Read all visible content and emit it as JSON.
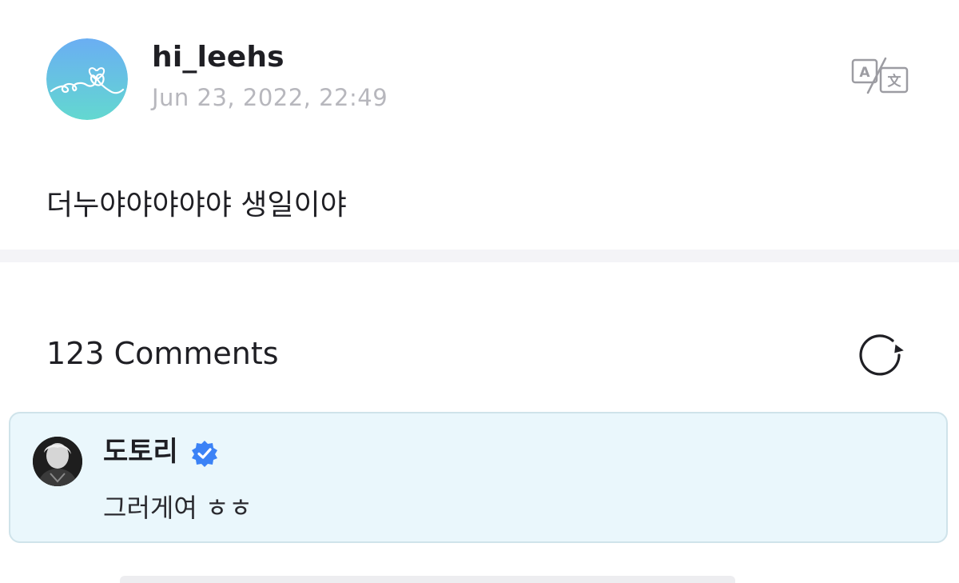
{
  "post": {
    "author": "hi_leehs",
    "timestamp": "Jun 23, 2022, 22:49",
    "body": "더누야야야야야 생일이야",
    "avatar_icon": "heart-doodle-icon",
    "translate_icon": "translate-icon"
  },
  "comments": {
    "count_label": "123 Comments",
    "refresh_icon": "refresh-icon",
    "items": [
      {
        "author": "도토리",
        "verified": true,
        "text": "그러게여 ㅎㅎ"
      }
    ]
  },
  "colors": {
    "primary_text": "#1f1f24",
    "muted_text": "#b7b7bd",
    "card_background": "#eaf7fc",
    "card_border": "#cfe3ea",
    "verified_badge": "#3b82f6",
    "avatar_gradient_top": "#6aaef3",
    "avatar_gradient_bottom": "#63d8d0"
  }
}
